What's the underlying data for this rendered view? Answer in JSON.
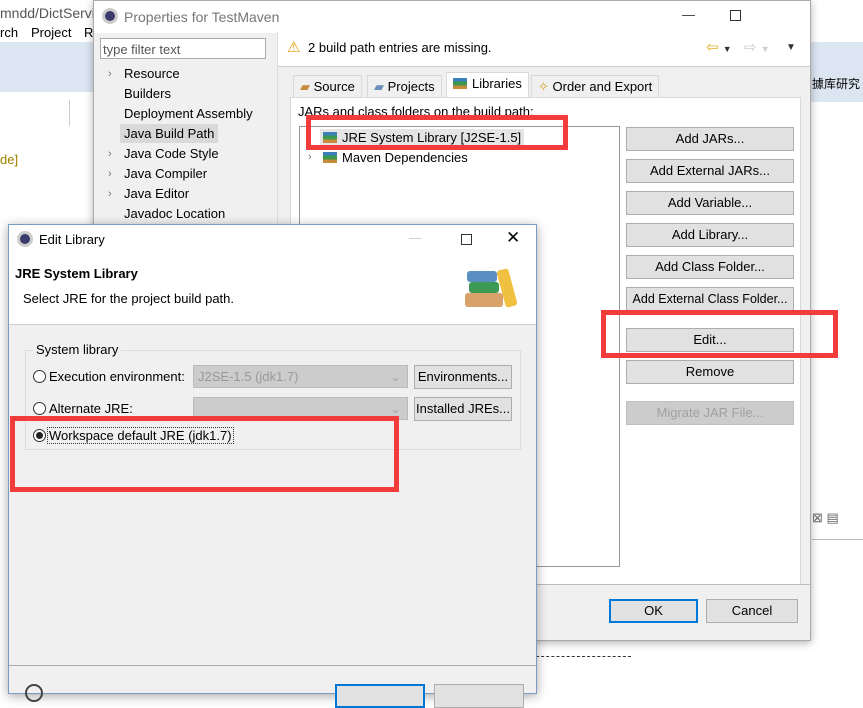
{
  "background_ide": {
    "title_fragment": "mndd/DictServic",
    "menu": [
      "rch",
      "Project",
      "R"
    ],
    "code_fragment": "de]",
    "right_text": "據库研究"
  },
  "properties": {
    "title": "Properties for TestMaven",
    "filter_placeholder": "type filter text",
    "tree": [
      {
        "label": "Resource",
        "expandable": true
      },
      {
        "label": "Builders",
        "expandable": false
      },
      {
        "label": "Deployment Assembly",
        "expandable": false
      },
      {
        "label": "Java Build Path",
        "expandable": false,
        "selected": true
      },
      {
        "label": "Java Code Style",
        "expandable": true
      },
      {
        "label": "Java Compiler",
        "expandable": true
      },
      {
        "label": "Java Editor",
        "expandable": true
      },
      {
        "label": "Javadoc Location",
        "expandable": false
      }
    ],
    "warning": "2 build path entries are missing.",
    "tabs": [
      "Source",
      "Projects",
      "Libraries",
      "Order and Export"
    ],
    "active_tab": "Libraries",
    "list_label": "JARs and class folders on the build path:",
    "entries": [
      "JRE System Library [J2SE-1.5]",
      "Maven Dependencies"
    ],
    "buttons": [
      "Add JARs...",
      "Add External JARs...",
      "Add Variable...",
      "Add Library...",
      "Add Class Folder...",
      "Add External Class Folder...",
      "Edit...",
      "Remove",
      "Migrate JAR File..."
    ],
    "ok": "OK",
    "cancel": "Cancel"
  },
  "edit_library": {
    "title": "Edit Library",
    "heading": "JRE System Library",
    "description": "Select JRE for the project build path.",
    "group_label": "System library",
    "option_exec": "Execution environment:",
    "exec_value": "J2SE-1.5 (jdk1.7)",
    "environments_button": "Environments...",
    "option_alt": "Alternate JRE:",
    "alt_value": "",
    "installed_button": "Installed JREs...",
    "option_workspace": "Workspace default JRE (jdk1.7)",
    "selected_option": "workspace"
  },
  "colors": {
    "highlight": "#f23c3c",
    "dialog_bg": "#f0f0f0",
    "accent": "#0078d7"
  }
}
